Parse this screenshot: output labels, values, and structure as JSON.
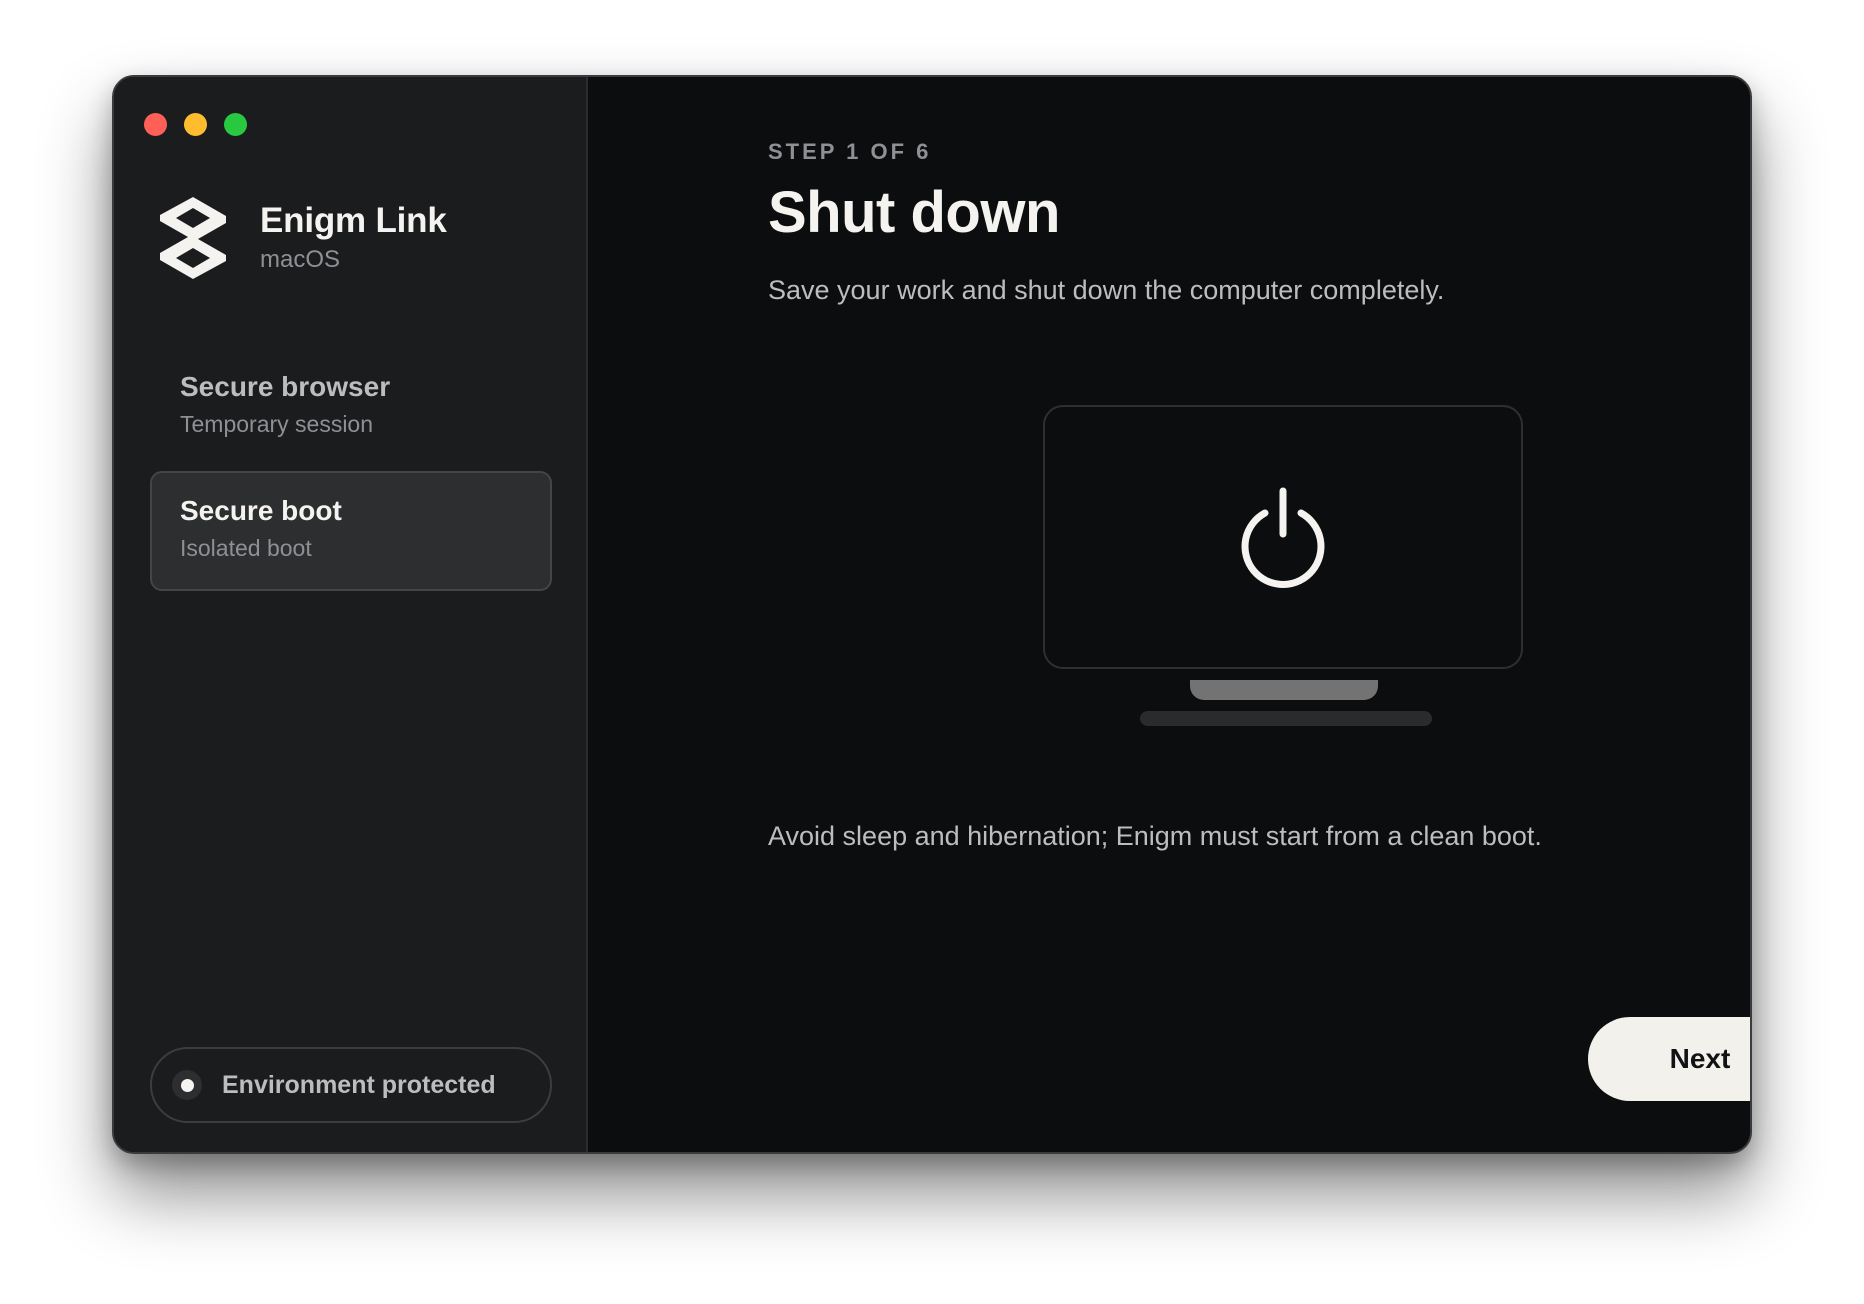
{
  "window": {
    "controls": [
      "close",
      "minimize",
      "maximize"
    ]
  },
  "brand": {
    "name": "Enigm Link",
    "platform": "macOS",
    "logo_icon": "enigm-logo-icon"
  },
  "sidebar": {
    "items": [
      {
        "title": "Secure browser",
        "subtitle": "Temporary session",
        "selected": false
      },
      {
        "title": "Secure boot",
        "subtitle": "Isolated boot",
        "selected": true
      }
    ],
    "status": {
      "label": "Environment protected",
      "icon": "status-dot-icon"
    }
  },
  "main": {
    "step_label": "STEP 1 OF 6",
    "title": "Shut down",
    "subtitle": "Save your work and shut down the computer completely.",
    "illustration_icon": "power-icon",
    "note": "Avoid sleep and hibernation; Enigm must start from a clean boot.",
    "next_label": "Next"
  },
  "colors": {
    "background": "#0c0d0f",
    "sidebar": "#1b1c1e",
    "selected_item": "#2d2e30",
    "primary_text": "#f4f3f0",
    "secondary_text": "#8f9094",
    "button_bg": "#f3f1ec",
    "close": "#fe5f57",
    "minimize": "#febc2e",
    "maximize": "#28c840"
  }
}
